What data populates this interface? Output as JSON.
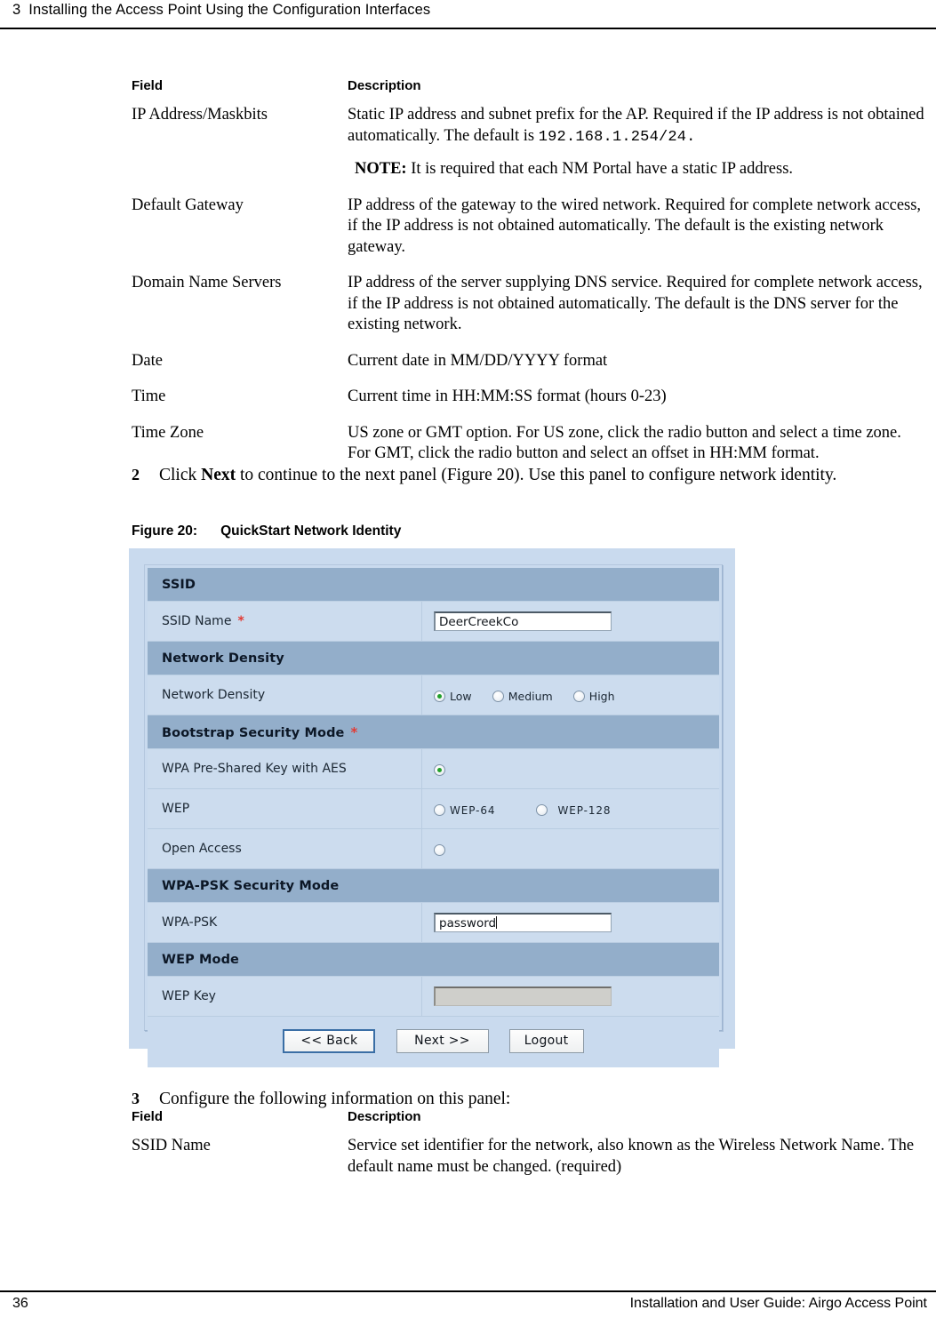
{
  "header": {
    "chapter_number": "3",
    "chapter_title": "Installing the Access Point Using the Configuration Interfaces"
  },
  "table1": {
    "col_field": "Field",
    "col_description": "Description",
    "rows": [
      {
        "field": "IP Address/Maskbits",
        "desc_pre": "Static IP address and subnet prefix for the AP. Required if the IP address is not obtained automatically. The default is ",
        "desc_mono": "192.168.1.254/24.",
        "note_label": "NOTE:",
        "note_text": " It is required that each NM Portal have a static IP address."
      },
      {
        "field": "Default Gateway",
        "desc": "IP address of the gateway to the wired network. Required for complete network access, if the IP address is not obtained automatically. The default is the existing network gateway."
      },
      {
        "field": "Domain Name Servers",
        "desc": "IP address of the server supplying DNS service. Required for complete network access, if the IP address is not obtained automatically. The default is the DNS server for the existing network."
      },
      {
        "field": "Date",
        "desc": "Current date in MM/DD/YYYY format"
      },
      {
        "field": "Time",
        "desc": "Current time in HH:MM:SS format (hours 0-23)"
      },
      {
        "field": "Time Zone",
        "desc": "US zone or GMT option. For US zone, click the radio button and select a time zone. For GMT, click the radio button and select an offset in HH:MM format."
      }
    ]
  },
  "step2": {
    "number": "2",
    "text_pre": "Click ",
    "text_bold": "Next",
    "text_post": " to continue to the next panel (Figure 20). Use this panel to configure network identity."
  },
  "figure": {
    "label": "Figure 20:",
    "title": "QuickStart Network Identity",
    "sections": {
      "ssid": {
        "heading": "SSID",
        "required_marker": "",
        "field_label": "SSID Name",
        "field_required_marker": "*",
        "field_value": "DeerCreekCo"
      },
      "density": {
        "heading": "Network Density",
        "field_label": "Network Density",
        "options": [
          {
            "label": "Low",
            "selected": true
          },
          {
            "label": "Medium",
            "selected": false
          },
          {
            "label": "High",
            "selected": false
          }
        ]
      },
      "bootstrap": {
        "heading": "Bootstrap Security Mode",
        "required_marker": "*",
        "rows": [
          {
            "label": "WPA Pre-Shared Key with AES",
            "options": [
              {
                "label": "",
                "selected": true
              }
            ]
          },
          {
            "label": "WEP",
            "options": [
              {
                "label": "WEP-64",
                "selected": false
              },
              {
                "label": "WEP-128",
                "selected": false
              }
            ]
          },
          {
            "label": "Open Access",
            "options": [
              {
                "label": "",
                "selected": false
              }
            ]
          }
        ]
      },
      "wpapsk": {
        "heading": "WPA-PSK Security Mode",
        "field_label": "WPA-PSK",
        "field_value": "password"
      },
      "wep": {
        "heading": "WEP Mode",
        "field_label": "WEP Key",
        "field_value": ""
      }
    },
    "buttons": [
      {
        "label": "<< Back",
        "default": true
      },
      {
        "label": "Next >>",
        "default": false
      },
      {
        "label": "Logout",
        "default": false
      }
    ]
  },
  "step3": {
    "number": "3",
    "text": "Configure the following information on this panel:"
  },
  "table2": {
    "col_field": "Field",
    "col_description": "Description",
    "rows": [
      {
        "field": "SSID Name",
        "desc": "Service set identifier for the network, also known as the Wireless Network Name. The default name must be changed. (required)"
      }
    ]
  },
  "footer": {
    "page_number": "36",
    "guide_title": "Installation and User Guide: Airgo Access Point"
  },
  "colors": {
    "section_header_bg": "#93aeca",
    "row_bg": "#ccdcee",
    "panel_bg": "#c9daee",
    "required_marker": "#e23a34",
    "radio_on": "#22a02a"
  }
}
